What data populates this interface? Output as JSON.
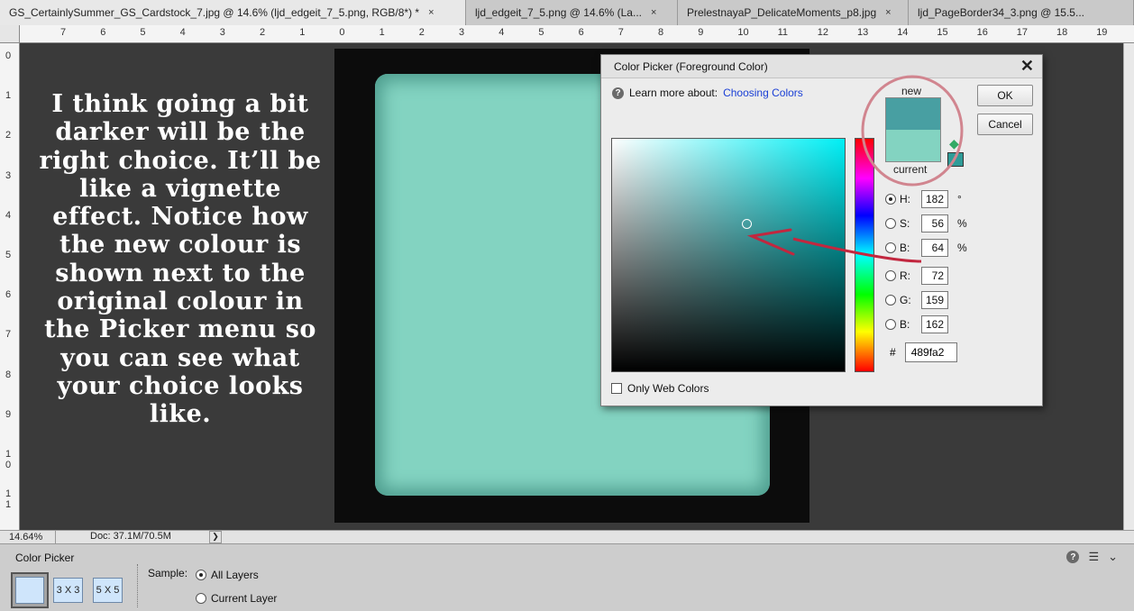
{
  "tabs": [
    {
      "label": "GS_CertainlySummer_GS_Cardstock_7.jpg @ 14.6% (ljd_edgeit_7_5.png, RGB/8*) *",
      "close": "×"
    },
    {
      "label": "ljd_edgeit_7_5.png @ 14.6% (La...",
      "close": "×"
    },
    {
      "label": "PrelestnayaP_DelicateMoments_p8.jpg",
      "close": "×"
    },
    {
      "label": "ljd_PageBorder34_3.png @ 15.5...",
      "close": "×"
    }
  ],
  "ruler_h": [
    "7",
    "6",
    "5",
    "4",
    "3",
    "2",
    "1",
    "0",
    "1",
    "2",
    "3",
    "4",
    "5",
    "6",
    "7",
    "8",
    "9",
    "10",
    "11",
    "12",
    "13",
    "14",
    "15",
    "16",
    "17",
    "18",
    "19"
  ],
  "ruler_v": [
    "0",
    "1",
    "2",
    "3",
    "4",
    "5",
    "6",
    "7",
    "8",
    "9",
    "1\n0",
    "1\n1"
  ],
  "overlay_text": "I think going a bit darker will be the right choice. It’ll be like a vignette effect. Notice how the new colour is shown next to the original colour in the Picker menu so you can see what your choice looks like.",
  "dialog": {
    "title": "Color Picker (Foreground Color)",
    "close": "✕",
    "learn_prefix": "Learn more about:",
    "learn_link": "Choosing Colors",
    "new_label": "new",
    "current_label": "current",
    "ok": "OK",
    "cancel": "Cancel",
    "fields": [
      {
        "label": "H:",
        "value": "182",
        "unit": "°",
        "selected": true
      },
      {
        "label": "S:",
        "value": "56",
        "unit": "%"
      },
      {
        "label": "B:",
        "value": "64",
        "unit": "%"
      },
      {
        "label": "R:",
        "value": "72",
        "unit": ""
      },
      {
        "label": "G:",
        "value": "159",
        "unit": ""
      },
      {
        "label": "B:",
        "value": "162",
        "unit": ""
      }
    ],
    "hash": "#",
    "hex": "489fa2",
    "web_colors": "Only Web Colors",
    "new_color": "#489fa2",
    "current_color": "#83d3c1"
  },
  "status": {
    "zoom": "14.64%",
    "doc": "Doc: 37.1M/70.5M",
    "arrow": "❯"
  },
  "options": {
    "title": "Color Picker",
    "size_3": "3 X 3",
    "size_5": "5 X 5",
    "sample_label": "Sample:",
    "all_layers": "All Layers",
    "current_layer": "Current Layer"
  }
}
